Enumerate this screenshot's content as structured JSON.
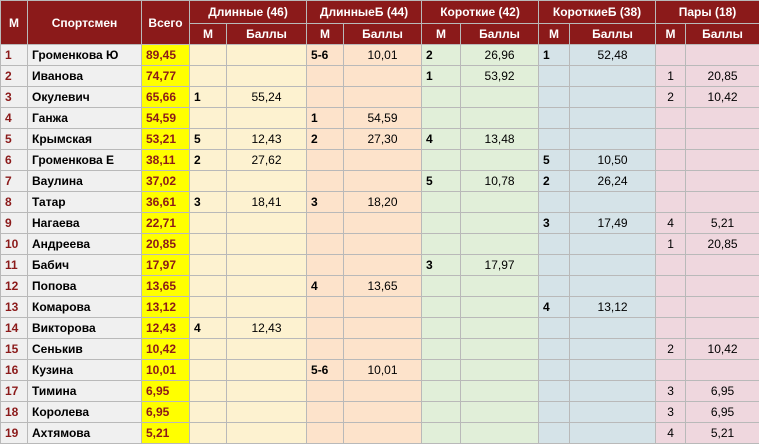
{
  "headers": {
    "place": "М",
    "athlete": "Спортсмен",
    "total": "Всего",
    "groups": [
      {
        "label": "Длинные (46)",
        "m": "М",
        "points": "Баллы"
      },
      {
        "label": "ДлинныеБ (44)",
        "m": "М",
        "points": "Баллы"
      },
      {
        "label": "Короткие (42)",
        "m": "М",
        "points": "Баллы"
      },
      {
        "label": "КороткиеБ (38)",
        "m": "М",
        "points": "Баллы"
      },
      {
        "label": "Пары (18)",
        "m": "М",
        "points": "Баллы"
      }
    ]
  },
  "rows": [
    {
      "n": "1",
      "name": "Громенкова Ю",
      "total": "89,45",
      "g": [
        [
          "",
          ""
        ],
        [
          "5-6",
          "10,01"
        ],
        [
          "2",
          "26,96"
        ],
        [
          "1",
          "52,48"
        ],
        [
          "",
          ""
        ]
      ]
    },
    {
      "n": "2",
      "name": "Иванова",
      "total": "74,77",
      "g": [
        [
          "",
          ""
        ],
        [
          "",
          ""
        ],
        [
          "1",
          "53,92"
        ],
        [
          "",
          ""
        ],
        [
          "1",
          "20,85"
        ]
      ]
    },
    {
      "n": "3",
      "name": "Окулевич",
      "total": "65,66",
      "g": [
        [
          "1",
          "55,24"
        ],
        [
          "",
          ""
        ],
        [
          "",
          ""
        ],
        [
          "",
          ""
        ],
        [
          "2",
          "10,42"
        ]
      ]
    },
    {
      "n": "4",
      "name": "Ганжа",
      "total": "54,59",
      "g": [
        [
          "",
          ""
        ],
        [
          "1",
          "54,59"
        ],
        [
          "",
          ""
        ],
        [
          "",
          ""
        ],
        [
          "",
          ""
        ]
      ]
    },
    {
      "n": "5",
      "name": "Крымская",
      "total": "53,21",
      "g": [
        [
          "5",
          "12,43"
        ],
        [
          "2",
          "27,30"
        ],
        [
          "4",
          "13,48"
        ],
        [
          "",
          ""
        ],
        [
          "",
          ""
        ]
      ]
    },
    {
      "n": "6",
      "name": "Громенкова Е",
      "total": "38,11",
      "g": [
        [
          "2",
          "27,62"
        ],
        [
          "",
          ""
        ],
        [
          "",
          ""
        ],
        [
          "5",
          "10,50"
        ],
        [
          "",
          ""
        ]
      ]
    },
    {
      "n": "7",
      "name": "Ваулина",
      "total": "37,02",
      "g": [
        [
          "",
          ""
        ],
        [
          "",
          ""
        ],
        [
          "5",
          "10,78"
        ],
        [
          "2",
          "26,24"
        ],
        [
          "",
          ""
        ]
      ]
    },
    {
      "n": "8",
      "name": "Татар",
      "total": "36,61",
      "g": [
        [
          "3",
          "18,41"
        ],
        [
          "3",
          "18,20"
        ],
        [
          "",
          ""
        ],
        [
          "",
          ""
        ],
        [
          "",
          ""
        ]
      ]
    },
    {
      "n": "9",
      "name": "Нагаева",
      "total": "22,71",
      "g": [
        [
          "",
          ""
        ],
        [
          "",
          ""
        ],
        [
          "",
          ""
        ],
        [
          "3",
          "17,49"
        ],
        [
          "4",
          "5,21"
        ]
      ]
    },
    {
      "n": "10",
      "name": "Андреева",
      "total": "20,85",
      "g": [
        [
          "",
          ""
        ],
        [
          "",
          ""
        ],
        [
          "",
          ""
        ],
        [
          "",
          ""
        ],
        [
          "1",
          "20,85"
        ]
      ]
    },
    {
      "n": "11",
      "name": "Бабич",
      "total": "17,97",
      "g": [
        [
          "",
          ""
        ],
        [
          "",
          ""
        ],
        [
          "3",
          "17,97"
        ],
        [
          "",
          ""
        ],
        [
          "",
          ""
        ]
      ]
    },
    {
      "n": "12",
      "name": "Попова",
      "total": "13,65",
      "g": [
        [
          "",
          ""
        ],
        [
          "4",
          "13,65"
        ],
        [
          "",
          ""
        ],
        [
          "",
          ""
        ],
        [
          "",
          ""
        ]
      ]
    },
    {
      "n": "13",
      "name": "Комарова",
      "total": "13,12",
      "g": [
        [
          "",
          ""
        ],
        [
          "",
          ""
        ],
        [
          "",
          ""
        ],
        [
          "4",
          "13,12"
        ],
        [
          "",
          ""
        ]
      ]
    },
    {
      "n": "14",
      "name": "Викторова",
      "total": "12,43",
      "g": [
        [
          "4",
          "12,43"
        ],
        [
          "",
          ""
        ],
        [
          "",
          ""
        ],
        [
          "",
          ""
        ],
        [
          "",
          ""
        ]
      ]
    },
    {
      "n": "15",
      "name": "Сенькив",
      "total": "10,42",
      "g": [
        [
          "",
          ""
        ],
        [
          "",
          ""
        ],
        [
          "",
          ""
        ],
        [
          "",
          ""
        ],
        [
          "2",
          "10,42"
        ]
      ]
    },
    {
      "n": "16",
      "name": "Кузина",
      "total": "10,01",
      "g": [
        [
          "",
          ""
        ],
        [
          "5-6",
          "10,01"
        ],
        [
          "",
          ""
        ],
        [
          "",
          ""
        ],
        [
          "",
          ""
        ]
      ]
    },
    {
      "n": "17",
      "name": "Тимина",
      "total": "6,95",
      "g": [
        [
          "",
          ""
        ],
        [
          "",
          ""
        ],
        [
          "",
          ""
        ],
        [
          "",
          ""
        ],
        [
          "3",
          "6,95"
        ]
      ]
    },
    {
      "n": "18",
      "name": "Королева",
      "total": "6,95",
      "g": [
        [
          "",
          ""
        ],
        [
          "",
          ""
        ],
        [
          "",
          ""
        ],
        [
          "",
          ""
        ],
        [
          "3",
          "6,95"
        ]
      ]
    },
    {
      "n": "19",
      "name": "Ахтямова",
      "total": "5,21",
      "g": [
        [
          "",
          ""
        ],
        [
          "",
          ""
        ],
        [
          "",
          ""
        ],
        [
          "",
          ""
        ],
        [
          "4",
          "5,21"
        ]
      ]
    }
  ]
}
